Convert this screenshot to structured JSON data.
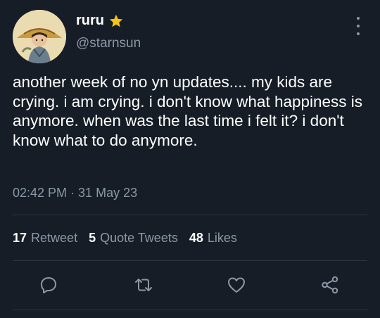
{
  "tweet": {
    "display_name": "ruru",
    "handle": "@starnsun",
    "verified_icon": "star-icon",
    "text": "another week of no yn updates.... my kids are crying. i am crying. i don't know what happiness is anymore. when was the last time i felt it? i don't know what to do anymore.",
    "time": "02:42 PM",
    "separator": " · ",
    "date": "31 May 23"
  },
  "stats": {
    "retweets_count": "17",
    "retweets_label": "Retweet",
    "quotes_count": "5",
    "quotes_label": "Quote Tweets",
    "likes_count": "48",
    "likes_label": "Likes"
  },
  "actions": [
    "reply-icon",
    "retweet-icon",
    "like-icon",
    "share-icon"
  ],
  "colors": {
    "background": "#161d26",
    "text": "#ffffff",
    "muted": "#8b98a5",
    "divider": "#2f3640",
    "star": "#f5c518"
  }
}
